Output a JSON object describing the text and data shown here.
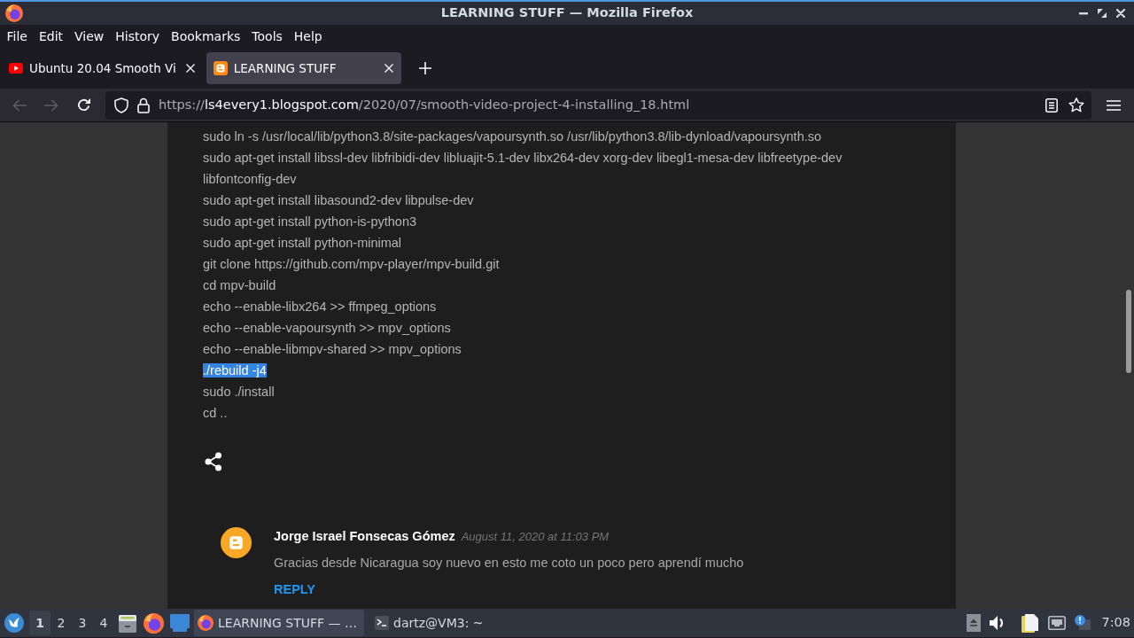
{
  "window": {
    "title": "LEARNING STUFF — Mozilla Firefox"
  },
  "menu_bar": [
    "File",
    "Edit",
    "View",
    "History",
    "Bookmarks",
    "Tools",
    "Help"
  ],
  "tabs": [
    {
      "title": "Ubuntu 20.04 Smooth Vi",
      "selected": false,
      "kind": "video"
    },
    {
      "title": "LEARNING STUFF",
      "selected": true,
      "kind": "blog"
    }
  ],
  "nav_bar": {
    "back": {
      "disabled": true
    },
    "forward": {
      "disabled": true
    },
    "url": {
      "scheme": "https://",
      "host": "ls4every1.blogspot.com",
      "path": "/2020/07/smooth-video-project-4-installing_18.html"
    }
  },
  "post": {
    "lines": [
      {
        "text": "sudo ln -s /usr/local/lib/python3.8/site-packages/vapoursynth.so /usr/lib/python3.8/lib-dynload/vapoursynth.so",
        "selected": false
      },
      {
        "text": "sudo apt-get install libssl-dev libfribidi-dev libluajit-5.1-dev libx264-dev xorg-dev libegl1-mesa-dev libfreetype-dev libfontconfig-dev",
        "selected": false
      },
      {
        "text": "sudo apt-get install libasound2-dev libpulse-dev",
        "selected": false
      },
      {
        "text": "sudo apt-get install python-is-python3",
        "selected": false
      },
      {
        "text": "sudo apt-get install python-minimal",
        "selected": false
      },
      {
        "text": "git clone https://github.com/mpv-player/mpv-build.git",
        "selected": false
      },
      {
        "text": "cd mpv-build",
        "selected": false
      },
      {
        "text": "echo --enable-libx264 >> ffmpeg_options",
        "selected": false
      },
      {
        "text": "echo --enable-vapoursynth >> mpv_options",
        "selected": false
      },
      {
        "text": "echo --enable-libmpv-shared >> mpv_options",
        "selected": false
      },
      {
        "text": "./rebuild -j4",
        "selected": true
      },
      {
        "text": "sudo ./install",
        "selected": false
      },
      {
        "text": "cd ..",
        "selected": false
      }
    ]
  },
  "comments": [
    {
      "author": "Jorge Israel Fonsecas Gómez",
      "date": "August 11, 2020 at 11:03 PM",
      "body": "Gracias desde Nicaragua soy nuevo en esto me coto un poco pero aprendí mucho",
      "reply": "REPLY"
    }
  ],
  "taskbar": {
    "workspaces": [
      {
        "label": "1",
        "selected": true
      },
      {
        "label": "2",
        "selected": false
      },
      {
        "label": "3",
        "selected": false
      },
      {
        "label": "4",
        "selected": false
      }
    ],
    "tasks": [
      {
        "title": "LEARNING STUFF — …",
        "selected": true,
        "kind": "browser"
      },
      {
        "title": "dartz@VM3: ~",
        "selected": false,
        "kind": "terminal"
      }
    ],
    "clock": "7:08"
  }
}
